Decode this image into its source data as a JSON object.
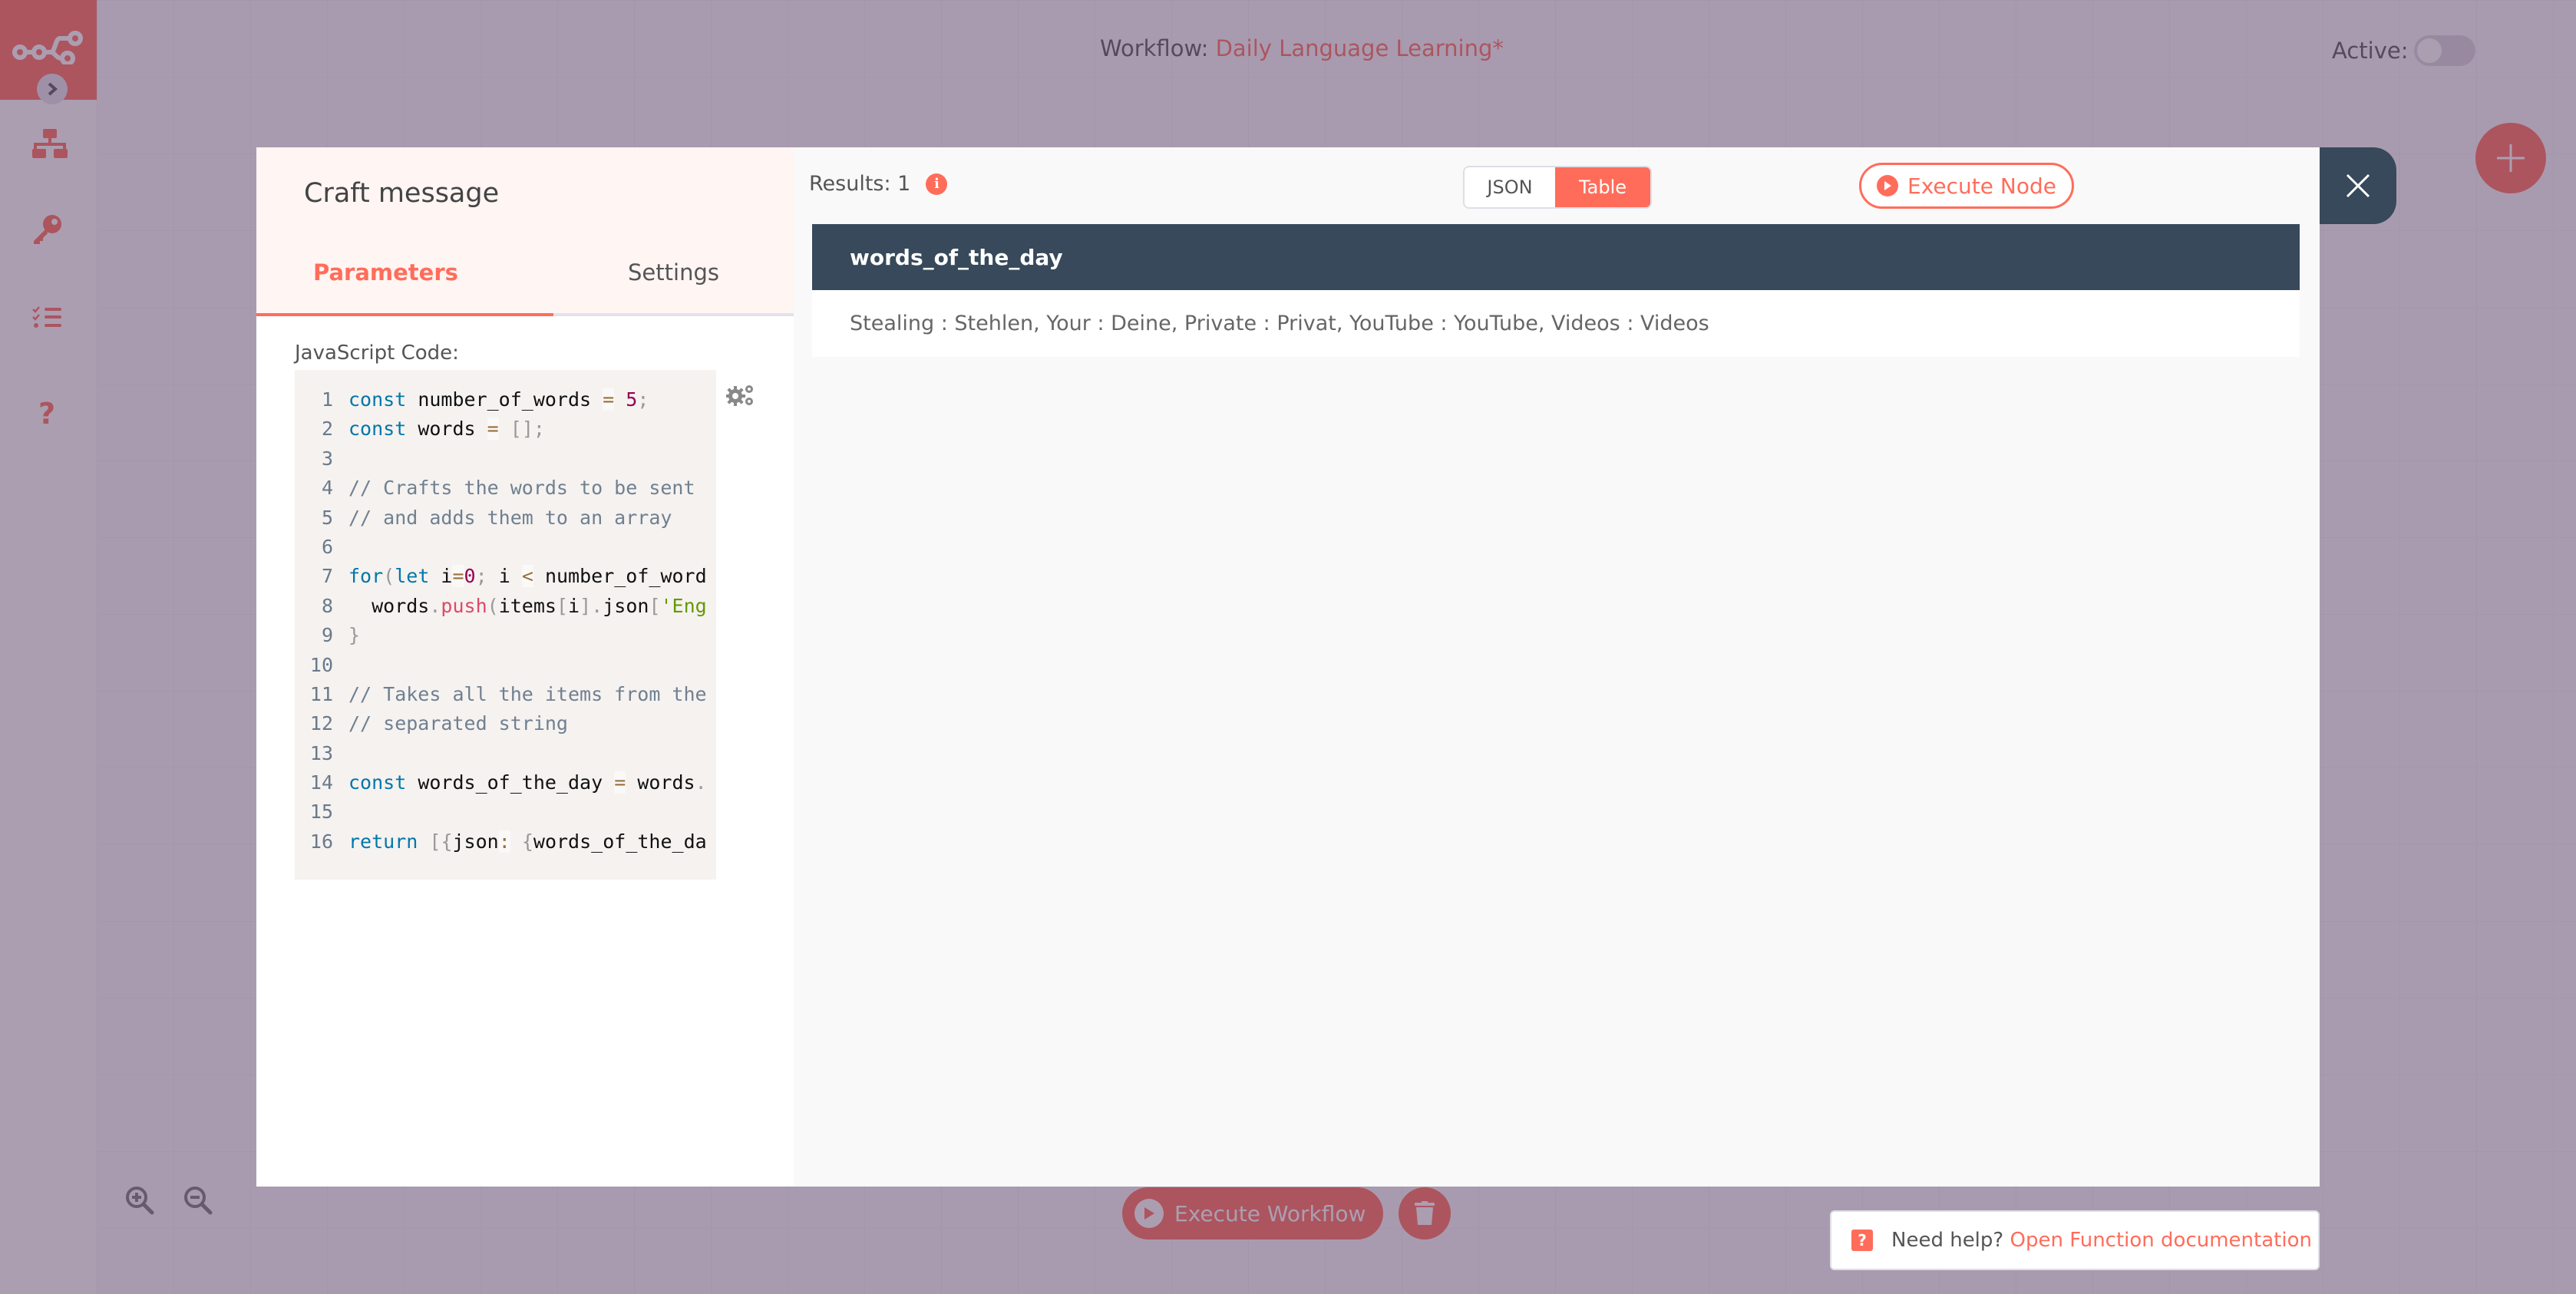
{
  "header": {
    "workflow_label": "Workflow: ",
    "workflow_name": "Daily Language Learning*",
    "active_label": "Active:",
    "active_state": false
  },
  "sidebar": {
    "logo_icon": "n8n-logo-icon",
    "expand_icon": "chevron-right-icon",
    "items": [
      {
        "icon": "network-icon",
        "name": "workflows"
      },
      {
        "icon": "key-icon",
        "name": "credentials"
      },
      {
        "icon": "task-list-icon",
        "name": "executions"
      },
      {
        "icon": "question-icon",
        "name": "help"
      }
    ]
  },
  "canvas": {
    "execute_workflow_label": "Execute Workflow",
    "zoom_in_icon": "zoom-in-icon",
    "zoom_out_icon": "zoom-out-icon",
    "delete_icon": "trash-icon",
    "add_node_icon": "plus-icon"
  },
  "modal": {
    "node_title": "Craft message",
    "tabs": [
      {
        "label": "Parameters",
        "active": true
      },
      {
        "label": "Settings",
        "active": false
      }
    ],
    "param_label": "JavaScript Code:",
    "code_lines": [
      "const number_of_words = 5;",
      "const words = [];",
      "",
      "// Crafts the words to be sent",
      "// and adds them to an array",
      "",
      "for(let i=0; i < number_of_word",
      "  words.push(items[i].json['Eng",
      "}",
      "",
      "// Takes all the items from the",
      "// separated string",
      "",
      "const words_of_the_day = words.",
      "",
      "return [{json: {words_of_the_da"
    ],
    "results_label": "Results: 1",
    "view_options": [
      {
        "label": "JSON",
        "selected": false
      },
      {
        "label": "Table",
        "selected": true
      }
    ],
    "execute_node_label": "Execute Node",
    "table": {
      "columns": [
        "words_of_the_day"
      ],
      "rows": [
        [
          "Stealing : Stehlen, Your : Deine, Private : Privat, YouTube : YouTube, Videos : Videos"
        ]
      ]
    }
  },
  "help": {
    "prefix": "Need help?",
    "link": "Open Function documentation"
  },
  "colors": {
    "accent": "#ff6d5a",
    "dark": "#37495a",
    "overlay": "#5a3e63"
  }
}
